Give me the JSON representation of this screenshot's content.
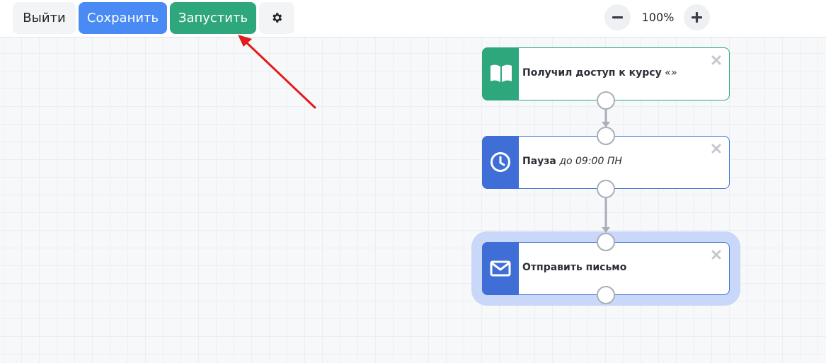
{
  "toolbar": {
    "exit_label": "Выйти",
    "save_label": "Сохранить",
    "run_label": "Запустить",
    "settings_icon": "gear-icon",
    "zoom_out_icon": "minus-icon",
    "zoom_level": "100%",
    "zoom_in_icon": "plus-icon"
  },
  "nodes": [
    {
      "type": "trigger",
      "icon": "book-icon",
      "title": "Получил доступ к курсу",
      "detail": "«»",
      "color": "#2ea77c"
    },
    {
      "type": "pause",
      "icon": "clock-icon",
      "title": "Пауза",
      "detail": "до 09:00 ПН",
      "color": "#3f6fd6"
    },
    {
      "type": "send-email",
      "icon": "envelope-icon",
      "title": "Отправить письмо",
      "detail": "",
      "color": "#3f6fd6",
      "selected": true
    }
  ],
  "colors": {
    "save": "#4a8af4",
    "run": "#2ea77c",
    "selection": "#c9d8f9",
    "annotation_arrow": "#e31b1b"
  }
}
